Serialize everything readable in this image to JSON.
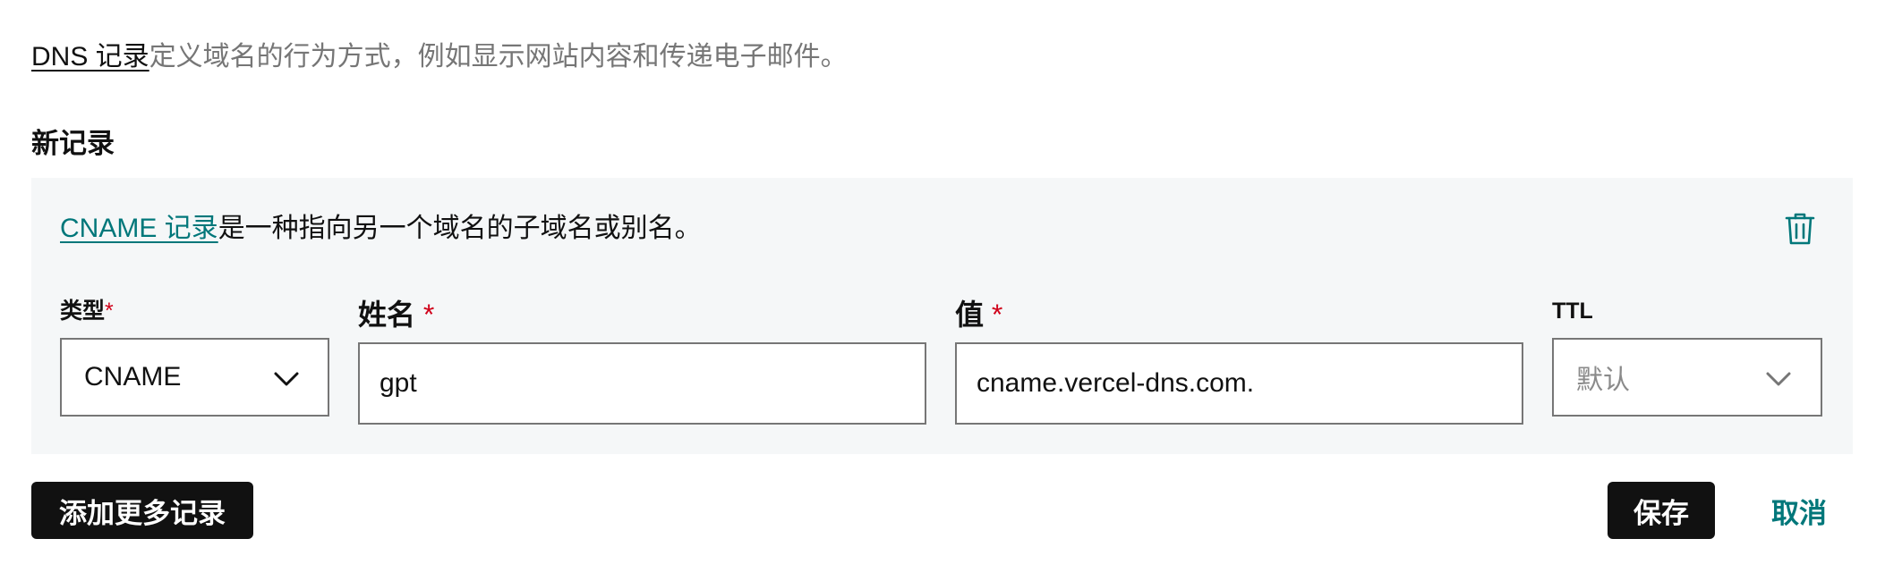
{
  "intro": {
    "link_text": "DNS 记录",
    "text": "定义域名的行为方式，例如显示网站内容和传递电子邮件。"
  },
  "section_title": "新记录",
  "record": {
    "desc_link": "CNAME 记录",
    "desc_text": "是一种指向另一个域名的子域名或别名。",
    "fields": {
      "type": {
        "label": "类型",
        "required_mark": "*",
        "value": "CNAME"
      },
      "name": {
        "label": "姓名",
        "required_mark": "*",
        "value": "gpt"
      },
      "value": {
        "label": "值",
        "required_mark": "*",
        "value": "cname.vercel-dns.com."
      },
      "ttl": {
        "label": "TTL",
        "placeholder": "默认"
      }
    }
  },
  "actions": {
    "add_more_label": "添加更多记录",
    "save_label": "保存",
    "cancel_label": "取消"
  },
  "colors": {
    "accent": "#00777a",
    "required": "#d0021b",
    "panel_bg": "#f5f7f8",
    "button_dark": "#111111"
  },
  "icons": {
    "delete": "trash-icon",
    "dropdown": "chevron-down-icon"
  }
}
